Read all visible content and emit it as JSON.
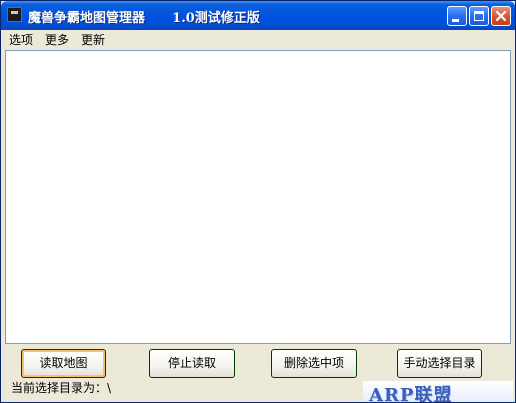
{
  "window": {
    "title": "魔兽争霸地图管理器      1.0测试修正版"
  },
  "menu": {
    "items": [
      {
        "label": "选项"
      },
      {
        "label": "更多"
      },
      {
        "label": "更新"
      }
    ]
  },
  "buttons": {
    "read_map": "读取地图",
    "stop_read": "停止读取",
    "delete_selected": "删除选中项",
    "manual_dir": "手动选择目录"
  },
  "status": {
    "text": "当前选择目录为：\\"
  },
  "logo": {
    "text": "ARP联盟"
  },
  "colors": {
    "titlebar": "#0053e1",
    "window_bg": "#ece9d8",
    "close_button": "#d8542e",
    "logo": "#3a5fb8"
  }
}
